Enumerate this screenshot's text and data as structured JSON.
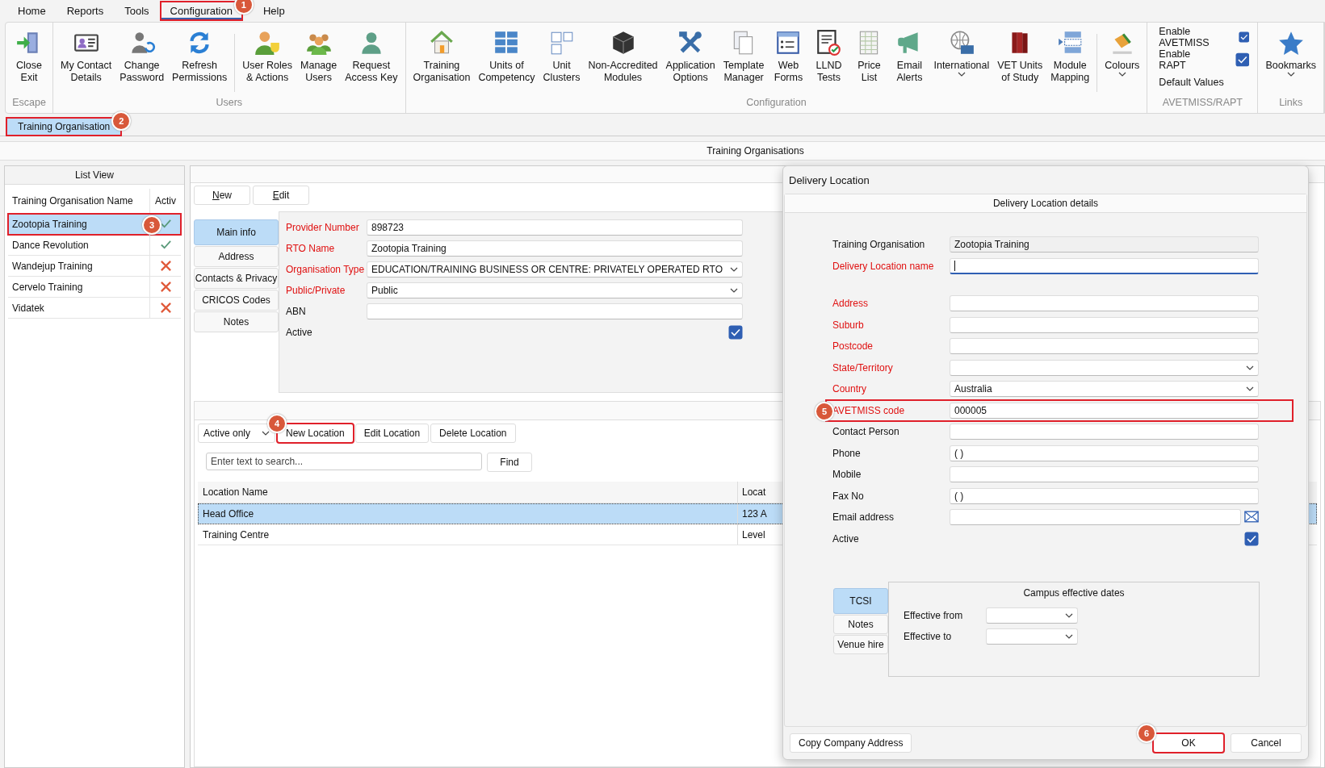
{
  "menu": [
    {
      "label": "Home",
      "selected": false
    },
    {
      "label": "Reports",
      "selected": false
    },
    {
      "label": "Tools",
      "selected": false
    },
    {
      "label": "Configuration",
      "selected": true,
      "callout": "1"
    },
    {
      "label": "Help",
      "selected": false
    }
  ],
  "ribbon": {
    "groups": [
      {
        "label": "Escape",
        "kind": "buttons",
        "items": [
          {
            "kind": "button",
            "lines": [
              "Close",
              "Exit"
            ]
          }
        ]
      },
      {
        "label": "Users",
        "kind": "buttons",
        "items": [
          {
            "kind": "button",
            "lines": [
              "My Contact",
              "Details"
            ]
          },
          {
            "kind": "button",
            "lines": [
              "Change",
              "Password"
            ]
          },
          {
            "kind": "button",
            "lines": [
              "Refresh",
              "Permissions"
            ]
          },
          {
            "kind": "separator"
          },
          {
            "kind": "button",
            "lines": [
              "User Roles",
              "& Actions"
            ]
          },
          {
            "kind": "button",
            "lines": [
              "Manage",
              "Users"
            ]
          },
          {
            "kind": "button",
            "lines": [
              "Request",
              "Access Key"
            ]
          }
        ]
      },
      {
        "label": "Configuration",
        "kind": "buttons",
        "items": [
          {
            "kind": "button",
            "lines": [
              "Training",
              "Organisation"
            ]
          },
          {
            "kind": "button",
            "lines": [
              "Units of",
              "Competency"
            ]
          },
          {
            "kind": "button",
            "lines": [
              "Unit",
              "Clusters"
            ]
          },
          {
            "kind": "button",
            "lines": [
              "Non-Accredited",
              "Modules"
            ]
          },
          {
            "kind": "button",
            "lines": [
              "Application",
              "Options"
            ]
          },
          {
            "kind": "button",
            "lines": [
              "Template",
              "Manager"
            ]
          },
          {
            "kind": "button",
            "lines": [
              "Web",
              "Forms"
            ]
          },
          {
            "kind": "button",
            "lines": [
              "LLND",
              "Tests"
            ]
          },
          {
            "kind": "button",
            "lines": [
              "Price",
              "List"
            ]
          },
          {
            "kind": "button",
            "lines": [
              "Email",
              "Alerts"
            ]
          },
          {
            "kind": "menu-button",
            "lines": [
              "International"
            ]
          },
          {
            "kind": "button",
            "lines": [
              "VET Units",
              "of Study"
            ]
          },
          {
            "kind": "button",
            "lines": [
              "Module",
              "Mapping"
            ]
          },
          {
            "kind": "separator"
          },
          {
            "kind": "menu-button",
            "lines": [
              "Colours"
            ]
          }
        ]
      },
      {
        "label": "AVETMISS/RAPT",
        "kind": "options",
        "items": [
          {
            "kind": "checkbox",
            "label": "Enable AVETMISS",
            "checked": true
          },
          {
            "kind": "checkbox",
            "label": "Enable RAPT",
            "checked": true
          },
          {
            "kind": "link",
            "label": "Default Values"
          }
        ]
      },
      {
        "label": "Links",
        "kind": "buttons",
        "items": [
          {
            "kind": "menu-button",
            "lines": [
              "Bookmarks"
            ]
          }
        ]
      }
    ]
  },
  "doc_tabs": [
    {
      "label": "Training Organisation",
      "selected": true,
      "callout": "2"
    }
  ],
  "panel_title": "Training Organisations",
  "list_view": {
    "title": "List View",
    "columns": [
      "Training Organisation Name",
      "Activ"
    ],
    "rows": [
      {
        "name": "Zootopia Training",
        "active": true,
        "selected": true,
        "callout": "3"
      },
      {
        "name": "Dance Revolution",
        "active": true,
        "selected": false
      },
      {
        "name": "Wandejup Training",
        "active": false,
        "selected": false
      },
      {
        "name": "Cervelo Training",
        "active": false,
        "selected": false
      },
      {
        "name": "Vidatek",
        "active": false,
        "selected": false
      }
    ]
  },
  "detail": {
    "toolbar": [
      "New",
      "Edit"
    ],
    "side_tabs": [
      {
        "label": "Main info",
        "selected": true
      },
      {
        "label": "Address",
        "selected": false
      },
      {
        "label": "Contacts & Privacy",
        "selected": false
      },
      {
        "label": "CRICOS Codes",
        "selected": false
      },
      {
        "label": "Notes",
        "selected": false
      }
    ],
    "fields": [
      {
        "label": "Provider Number",
        "kind": "text",
        "required": true,
        "value": "898723"
      },
      {
        "label": "RTO Name",
        "kind": "text",
        "required": true,
        "value": "Zootopia Training"
      },
      {
        "label": "Organisation Type",
        "kind": "select",
        "required": true,
        "value": "EDUCATION/TRAINING BUSINESS OR CENTRE: PRIVATELY OPERATED RTO"
      },
      {
        "label": "Public/Private",
        "kind": "select",
        "required": true,
        "value": "Public"
      },
      {
        "label": "ABN",
        "kind": "text",
        "required": false
      },
      {
        "label": "Active",
        "kind": "checkbox",
        "required": false,
        "checked": true
      }
    ]
  },
  "locations": {
    "filter": "Active only",
    "buttons": [
      {
        "label": "New Location",
        "callout": "4"
      },
      {
        "label": "Edit Location"
      },
      {
        "label": "Delete Location"
      }
    ],
    "search": {
      "placeholder": "Enter text to search...",
      "button": "Find"
    },
    "columns": [
      "Location Name",
      "Locat"
    ],
    "rows": [
      {
        "cells": [
          "Head Office",
          "123 A"
        ],
        "selected": true
      },
      {
        "cells": [
          "Training Centre",
          "Level"
        ],
        "selected": false
      }
    ]
  },
  "dialog": {
    "title": "Delivery Location",
    "section": "Delivery Location details",
    "top_fields": [
      {
        "label": "Training Organisation",
        "kind": "readonly",
        "required": false,
        "value": "Zootopia Training",
        "focused": false
      },
      {
        "label": "Delivery Location name",
        "kind": "text",
        "required": true,
        "focused": true
      }
    ],
    "fields": [
      {
        "label": "Address",
        "kind": "text",
        "required": true
      },
      {
        "label": "Suburb",
        "kind": "text",
        "required": true
      },
      {
        "label": "Postcode",
        "kind": "text",
        "required": true
      },
      {
        "label": "State/Territory",
        "kind": "select",
        "required": true
      },
      {
        "label": "Country",
        "kind": "select",
        "required": true,
        "value": "Australia"
      },
      {
        "label": "AVETMISS code",
        "kind": "text",
        "required": true,
        "value": "000005",
        "callout": "5"
      },
      {
        "label": "Contact Person",
        "kind": "text",
        "required": false
      },
      {
        "label": "Phone",
        "kind": "text",
        "required": false,
        "value": "( )"
      },
      {
        "label": "Mobile",
        "kind": "text",
        "required": false
      },
      {
        "label": "Fax No",
        "kind": "text",
        "required": false,
        "value": "( )"
      },
      {
        "label": "Email address",
        "kind": "email",
        "required": false
      },
      {
        "label": "Active",
        "kind": "checkbox",
        "required": false,
        "checked": true
      }
    ],
    "sub_tabs": [
      {
        "label": "TCSI",
        "selected": true
      },
      {
        "label": "Notes",
        "selected": false
      },
      {
        "label": "Venue hire",
        "selected": false
      }
    ],
    "dates_panel": {
      "title": "Campus effective dates",
      "fields": [
        {
          "label": "Effective from"
        },
        {
          "label": "Effective to"
        }
      ]
    },
    "footer": {
      "left": "Copy Company Address",
      "buttons": [
        {
          "label": "OK",
          "callout": "6"
        },
        {
          "label": "Cancel"
        }
      ]
    }
  }
}
